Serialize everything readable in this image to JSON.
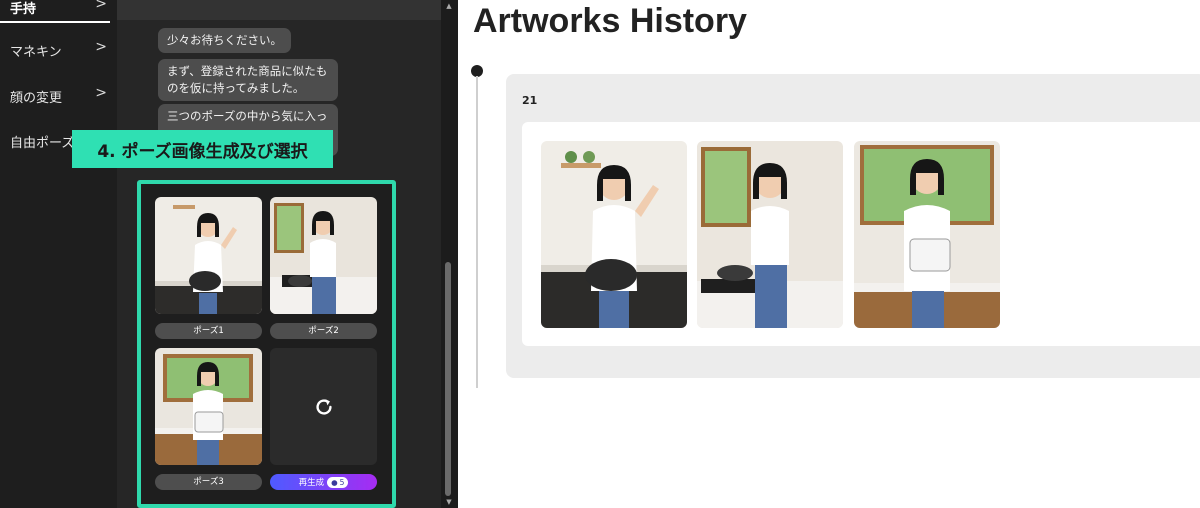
{
  "sidebar": {
    "items": [
      {
        "label": "手持",
        "active": true
      },
      {
        "label": "マネキン"
      },
      {
        "label": "顔の変更"
      },
      {
        "label": "自由ポーズ"
      }
    ]
  },
  "chat": {
    "messages": [
      "少々お待ちください。",
      "まず、登録された商品に似たものを仮に持ってみました。",
      "三つのポーズの中から気に入っ"
    ]
  },
  "badge": {
    "text": "4. ポーズ画像生成及び選択"
  },
  "poses": {
    "items": [
      {
        "label": "ポーズ1"
      },
      {
        "label": "ポーズ2"
      },
      {
        "label": "ポーズ3"
      }
    ],
    "regenerate": {
      "label": "再生成",
      "cost": "5",
      "icon": "refresh-icon"
    }
  },
  "history": {
    "title": "Artworks History",
    "entry": {
      "number": "21"
    }
  },
  "colors": {
    "accent": "#2fe0b3",
    "panel_dark": "#1c1c1c",
    "regen_gradient": [
      "#4e5bff",
      "#a62cf2"
    ]
  }
}
